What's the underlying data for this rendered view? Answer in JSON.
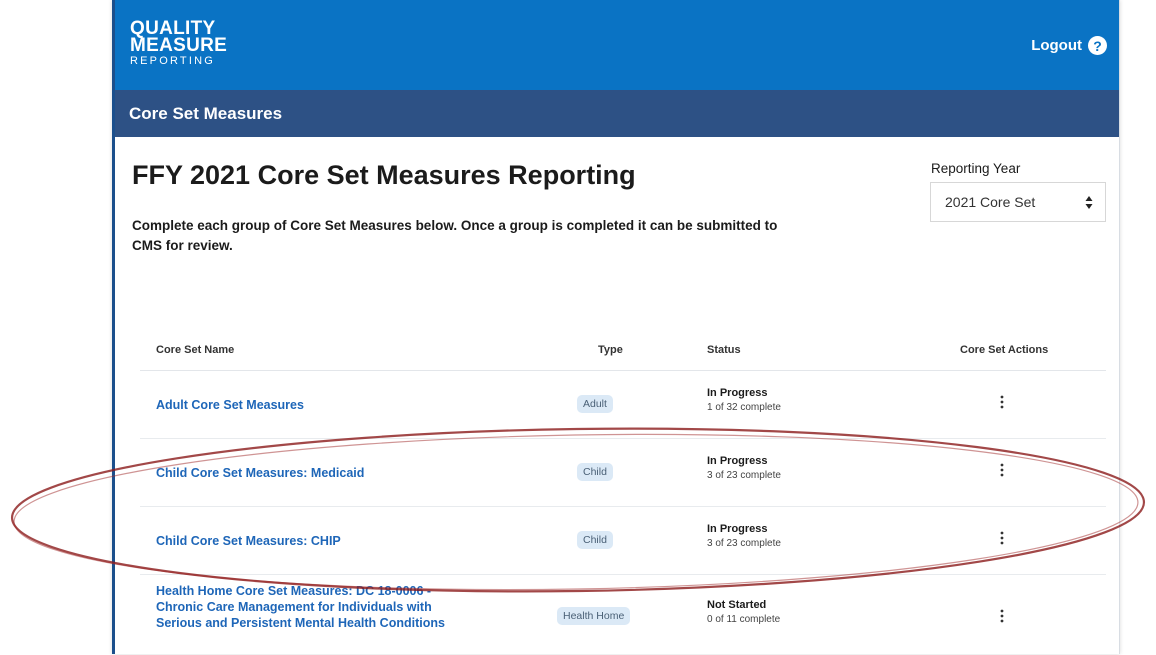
{
  "header": {
    "logo_line1": "QUALITY",
    "logo_line2": "MEASURE",
    "logo_line3": "REPORTING",
    "logout_label": "Logout",
    "help_icon": "?"
  },
  "subnav": {
    "title": "Core Set Measures"
  },
  "main": {
    "title": "FFY 2021 Core Set Measures Reporting",
    "intro": "Complete each group of Core Set Measures below. Once a group is completed it can be submitted to CMS for review."
  },
  "reporting_year": {
    "label": "Reporting Year",
    "selected": "2021 Core Set"
  },
  "table": {
    "headers": [
      "Core Set Name",
      "Type",
      "Status",
      "Core Set Actions"
    ],
    "rows": [
      {
        "name": "Adult Core Set Measures",
        "type": "Adult",
        "status": "In Progress",
        "count": "1 of 32 complete"
      },
      {
        "name": "Child Core Set Measures: Medicaid",
        "type": "Child",
        "status": "In Progress",
        "count": "3 of 23 complete"
      },
      {
        "name": "Child Core Set Measures: CHIP",
        "type": "Child",
        "status": "In Progress",
        "count": "3 of 23 complete"
      },
      {
        "name": "Health Home Core Set Measures: DC 18-0006 - Chronic Care Management for Individuals with Serious and Persistent Mental Health Conditions",
        "type": "Health Home",
        "status": "Not Started",
        "count": "0 of 11 complete"
      }
    ]
  },
  "colors": {
    "header_bg": "#0a73c4",
    "subnav_bg": "#2d5185",
    "link": "#1e66b8",
    "tag_bg": "#dbe9f6",
    "annotation": "#8b1a1a"
  },
  "icons": {
    "help": "question-circle-icon",
    "select": "sort-updown-icon",
    "actions": "kebab-menu-icon"
  }
}
